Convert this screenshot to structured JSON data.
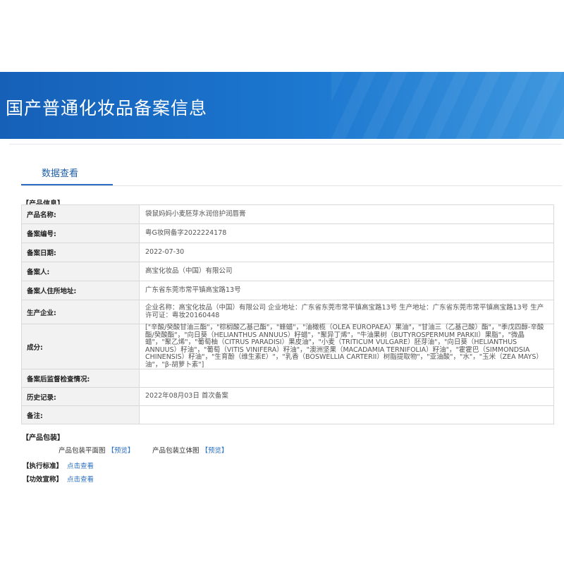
{
  "banner": {
    "title": "国产普通化妆品备案信息"
  },
  "tabs": [
    {
      "label": "数据查看"
    }
  ],
  "product_info": {
    "section_label": "【产品信息】",
    "rows": [
      {
        "key": "产品名称:",
        "value": "袋鼠妈妈小麦胚芽水润倍护润唇膏"
      },
      {
        "key": "备案编号:",
        "value": "粤G妆网备字2022224178"
      },
      {
        "key": "备案日期:",
        "value": "2022-07-30"
      },
      {
        "key": "备案人:",
        "value": "高宝化妆品（中国）有限公司"
      },
      {
        "key": "备案人住所地址:",
        "value": "广东省东莞市常平镇高宝路13号"
      },
      {
        "key": "生产企业:",
        "value": "企业名称：高宝化妆品（中国）有限公司 企业地址：广东省东莞市常平镇高宝路13号 生产地址：广东省东莞市常平镇高宝路13号 生产许可证：粤妆20160448"
      },
      {
        "key": "成分:",
        "value": "[\"辛酸/癸酸甘油三酯\"，\"棕榈酸乙基己酯\"，\"蜂蜡\"，\"油橄榄（OLEA EUROPAEA）果油\"，\"甘油三（乙基己酸）酯\"，\"季戊四醇-辛酸酯/癸酸酯\"，\"向日葵（HELIANTHUS ANNUUS）籽蜡\"，\"聚异丁烯\"，\"牛油果树（BUTYROSPERMUM PARKII）果脂\"，\"微晶蜡\"，\"聚乙烯\"，\"葡萄柚（CITRUS PARADISI）果皮油\"，\"小麦（TRITICUM VULGARE）胚芽油\"，\"向日葵（HELIANTHUS ANNUUS）籽油\"，\"葡萄（VITIS VINIFERA）籽油\"，\"澳洲坚果（MACADAMIA TERNIFOLIA）籽油\"，\"霍霍巴（SIMMONDSIA CHINENSIS）籽油\"，\"生育酚（维生素E）\"，\"乳香（BOSWELLIA CARTERII）树脂提取物\"，\"亚油酸\"，\"水\"，\"玉米（ZEA MAYS）油\"，\"β-胡萝卜素\"]"
      },
      {
        "key": "备案后监督检查情况:",
        "value": ""
      },
      {
        "key": "历史记录:",
        "value": "2022年08月03日 首次备案"
      },
      {
        "key": "备注:",
        "value": ""
      }
    ]
  },
  "packaging": {
    "section_label": "【产品包装】",
    "plan_label": "产品包装平面图",
    "plan_link": "【预览】",
    "stereo_label": "产品包装立体图",
    "stereo_link": "【预览】"
  },
  "standard": {
    "label": "【执行标准】",
    "link": "点击查看"
  },
  "efficacy": {
    "label": "【功效宣称】",
    "link": "点击查看"
  }
}
